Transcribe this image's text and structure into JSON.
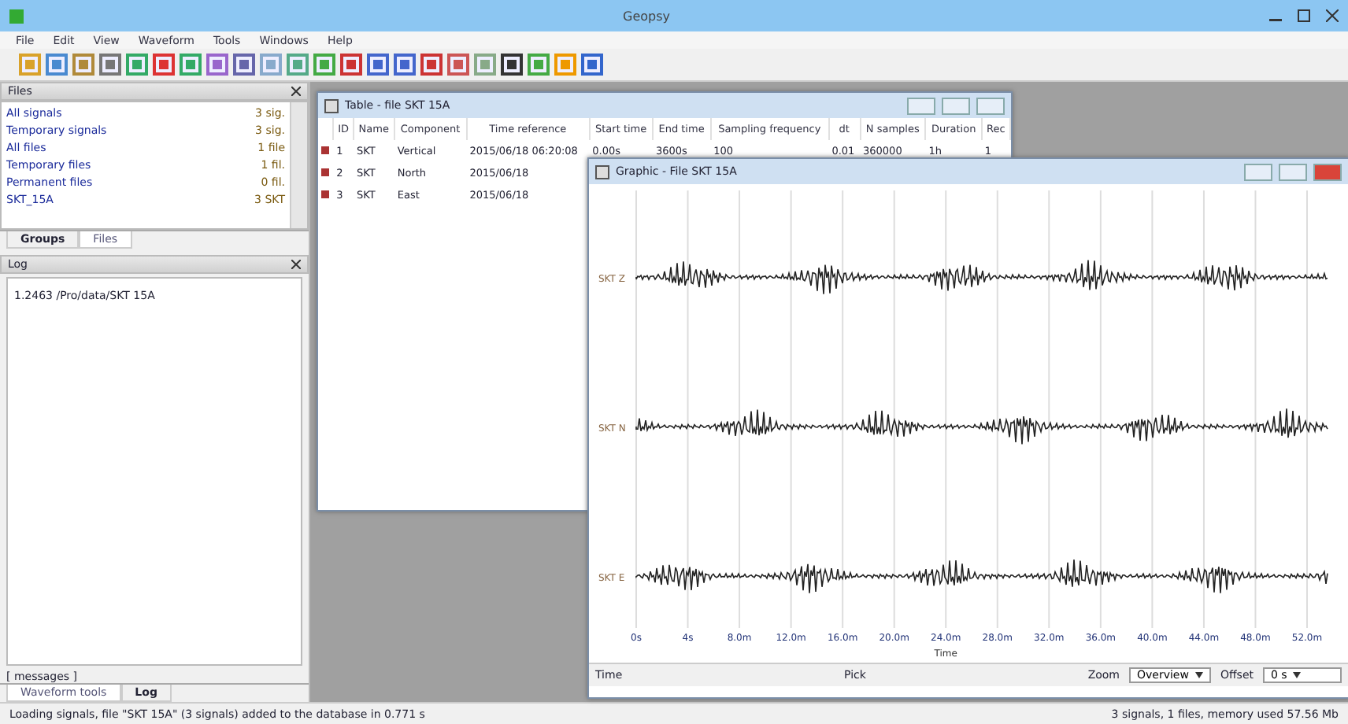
{
  "app": {
    "title": "Geopsy",
    "menu": [
      "File",
      "Edit",
      "View",
      "Waveform",
      "Tools",
      "Windows",
      "Help"
    ]
  },
  "files_panel": {
    "title": "Files",
    "items": [
      {
        "name": "All signals",
        "count": "3 sig."
      },
      {
        "name": "Temporary signals",
        "count": "3 sig."
      },
      {
        "name": "All files",
        "count": "1 file"
      },
      {
        "name": "Temporary files",
        "count": "1 fil."
      },
      {
        "name": "Permanent files",
        "count": "0 fil."
      },
      {
        "name": "SKT_15A",
        "count": "3 SKT"
      }
    ],
    "tabs": [
      {
        "label": "Groups",
        "selected": true
      },
      {
        "label": "Files",
        "selected": false
      }
    ]
  },
  "log_panel": {
    "title": "Log",
    "lines": [
      "1.2463 /Pro/data/SKT 15A"
    ],
    "caption": "[ messages ]"
  },
  "bottom_tabs": [
    {
      "label": "Waveform tools",
      "selected": false
    },
    {
      "label": "Log",
      "selected": true
    }
  ],
  "table_window": {
    "title": "Table - file SKT 15A",
    "columns": [
      "ID",
      "Name",
      "Component",
      "Time reference",
      "Start time",
      "End time",
      "Sampling frequency",
      "dt",
      "N samples",
      "Duration",
      "Rec"
    ],
    "rows": [
      [
        "1",
        "SKT",
        "Vertical",
        "2015/06/18 06:20:08",
        "0.00s",
        "3600s",
        "100",
        "0.01",
        "360000",
        "1h",
        "1"
      ],
      [
        "2",
        "SKT",
        "North",
        "2015/06/18",
        "",
        "",
        "",
        "",
        "",
        "",
        ""
      ],
      [
        "3",
        "SKT",
        "East",
        "2015/06/18",
        "",
        "",
        "",
        "",
        "",
        "",
        ""
      ]
    ]
  },
  "graphic_window": {
    "title": "Graphic - File SKT 15A",
    "traces": [
      {
        "label": "SKT Z"
      },
      {
        "label": "SKT N"
      },
      {
        "label": "SKT E"
      }
    ],
    "xticks": [
      "0s",
      "4s",
      "8.0m",
      "12.0m",
      "16.0m",
      "20.0m",
      "24.0m",
      "28.0m",
      "32.0m",
      "36.0m",
      "40.0m",
      "44.0m",
      "48.0m",
      "52.0m"
    ],
    "axis_label": "Time",
    "time_label": "Time",
    "pick_label": "Pick",
    "zoom_label": "Zoom",
    "zoom_value": "Overview",
    "offset_label": "Offset",
    "offset_value": "0 s"
  },
  "status": {
    "message": "Loading signals, file \"SKT 15A\" (3 signals) added to the database in 0.771 s",
    "info": "3 signals, 1 files, memory used 57.56 Mb"
  }
}
